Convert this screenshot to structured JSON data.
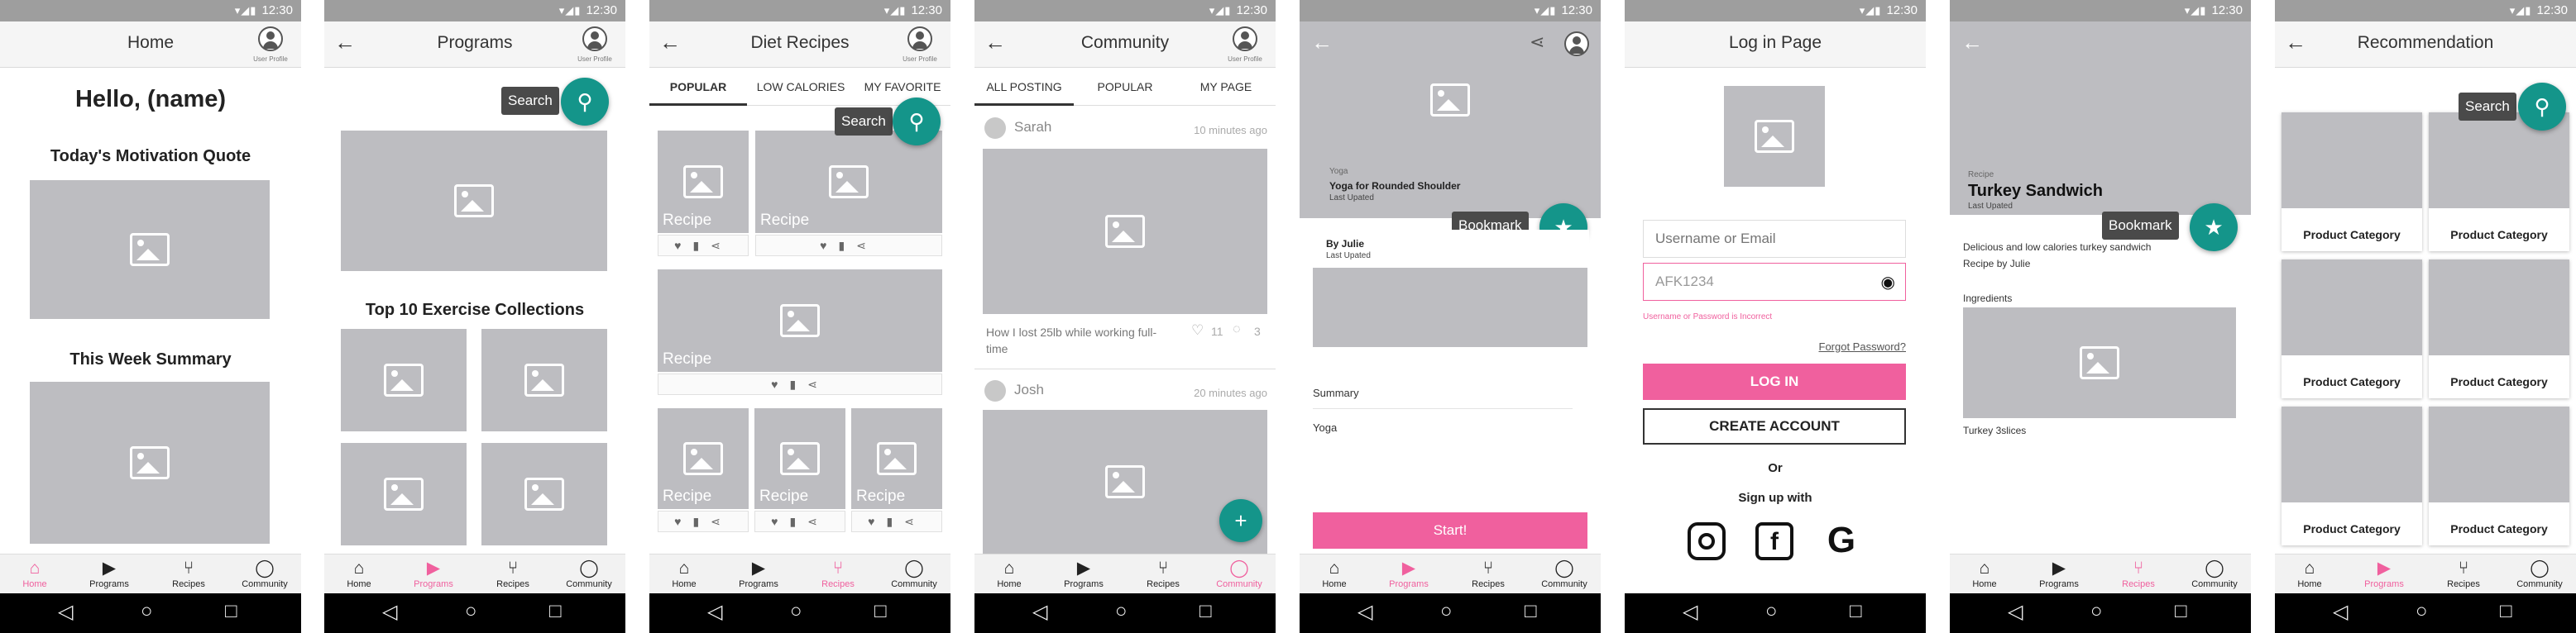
{
  "status": {
    "time": "12:30",
    "icons": "▾◢▮"
  },
  "profile_label": "User Profile",
  "nav": [
    "Home",
    "Programs",
    "Recipes",
    "Community"
  ],
  "nav_icons": [
    "home-icon",
    "play-icon",
    "cutlery-icon",
    "chat-icon"
  ],
  "accent_color": "#f0609e",
  "fab_color": "#14958a",
  "home": {
    "title": "Home",
    "greeting": "Hello, (name)",
    "quote_heading": "Today's Motivation Quote",
    "summary_heading": "This Week Summary"
  },
  "programs": {
    "title": "Programs",
    "search_tip": "Search",
    "collections_heading": "Top 10 Exercise Collections"
  },
  "diet": {
    "title": "Diet Recipes",
    "tabs": [
      "POPULAR",
      "LOW CALORIES",
      "MY FAVORITE"
    ],
    "search_tip": "Search",
    "recipe_label": "Recipe"
  },
  "community": {
    "title": "Community",
    "tabs": [
      "ALL POSTING",
      "POPULAR",
      "MY PAGE"
    ],
    "posts": [
      {
        "user": "Sarah",
        "time": "10 minutes ago",
        "text": "How I lost 25lb while working full-time",
        "likes": "11",
        "comments": "3"
      },
      {
        "user": "Josh",
        "time": "20 minutes ago"
      }
    ]
  },
  "program_detail": {
    "category": "Yoga",
    "title": "Yoga for Rounded Shoulder",
    "updated": "Last Upated",
    "bookmark_tip": "Bookmark",
    "author": "By Julie",
    "author_updated": "Last Upated",
    "summary_label": "Summary",
    "summary_value": "Yoga",
    "start": "Start!"
  },
  "login": {
    "title": "Log in Page",
    "username_placeholder": "Username or Email",
    "password_value": "AFK1234",
    "error": "Username or Password is Incorrect",
    "forgot": "Forgot Password?",
    "login_btn": "LOG IN",
    "create_btn": "CREATE ACCOUNT",
    "or": "Or",
    "signup_with": "Sign up with"
  },
  "recipe_detail": {
    "category": "Recipe",
    "title": "Turkey Sandwich",
    "updated": "Last Upated",
    "bookmark_tip": "Bookmark",
    "description": "Delicious and low calories turkey sandwich",
    "author": "Recipe by Julie",
    "ingredients_label": "Ingredients",
    "ingredient": "Turkey 3slices"
  },
  "recommendation": {
    "title": "Recommendation",
    "search_tip": "Search",
    "card_label": "Product Category"
  }
}
